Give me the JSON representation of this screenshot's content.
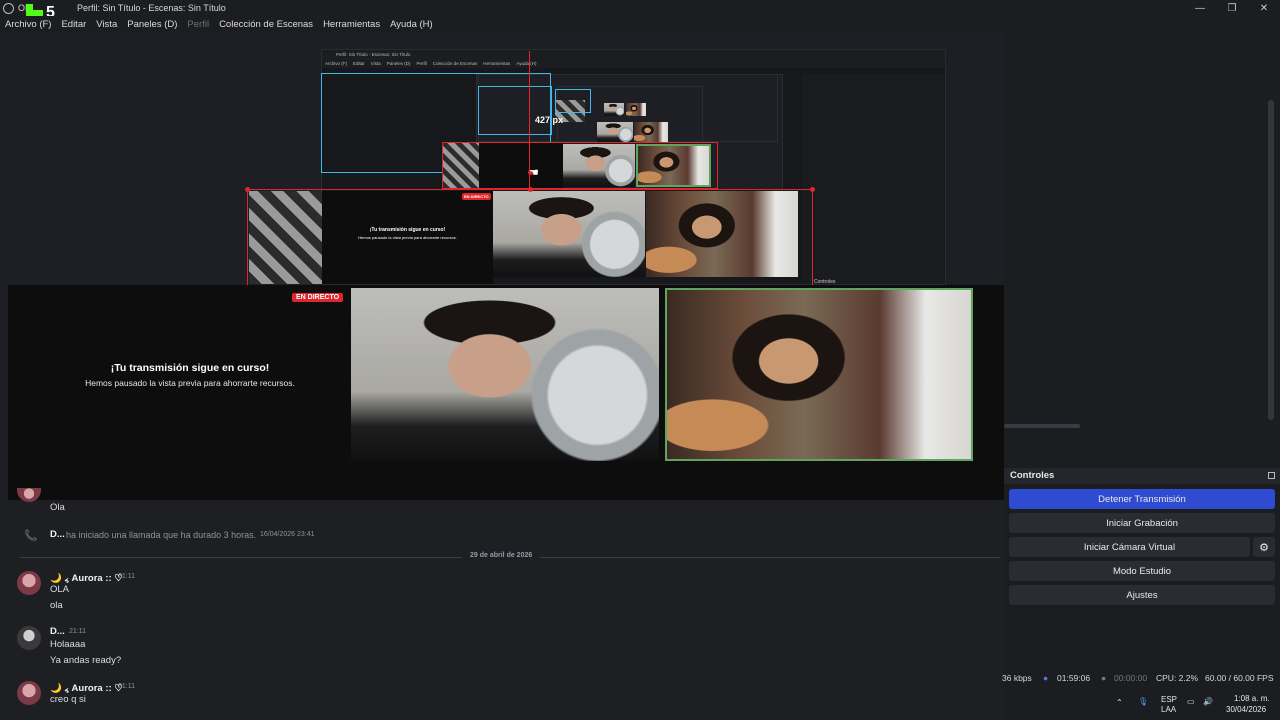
{
  "window": {
    "title": "Perfil: Sin Título - Escenas: Sin Título",
    "title_prefix": "OB",
    "minimize": "—",
    "maximize": "❐",
    "close": "✕"
  },
  "overlay_logo": {
    "letter": "K",
    "number": "5",
    "color": "#53fc18"
  },
  "menu": [
    {
      "label": "Archivo (F)",
      "disabled": false
    },
    {
      "label": "Editar",
      "disabled": false
    },
    {
      "label": "Vista",
      "disabled": false
    },
    {
      "label": "Paneles (D)",
      "disabled": false
    },
    {
      "label": "Perfil",
      "disabled": true
    },
    {
      "label": "Colección de Escenas",
      "disabled": false
    },
    {
      "label": "Herramientas",
      "disabled": false
    },
    {
      "label": "Ayuda (H)",
      "disabled": false
    }
  ],
  "preview": {
    "measure_label": "427 px",
    "live_badge": "EN DIRECTO",
    "paused_title": "¡Tu transmisión sigue en curso!",
    "paused_subtitle": "Hemos pausado la vista previa para ahorrarte recursos.",
    "nested_title": "Perfil: Sin Título - Escenas: Sin Título",
    "nested_menu": [
      "Archivo (F)",
      "Editar",
      "Vista",
      "Paneles (D)",
      "Perfil",
      "Colección de Escenas",
      "Herramientas",
      "Ayuda (H)"
    ],
    "nested_controls": "Controles",
    "highlight_color": "#e0262b",
    "selection_color": "#44b7e8"
  },
  "chat": {
    "top_message": "Ola",
    "call_user": "D...",
    "call_text": "ha iniciado una llamada que ha durado 3 horas.",
    "call_time": "16/04/2026 23:41",
    "date_divider": "29 de abril de 2026",
    "messages": [
      {
        "user": "🌙 ៹ Aurora :: ♡",
        "time": "21:11",
        "lines": [
          "OLA",
          "ola"
        ]
      },
      {
        "user": "D...",
        "time": "21:11",
        "lines": [
          "Holaaaa",
          "Ya andas ready?"
        ]
      },
      {
        "user": "🌙 ៹ Aurora :: ♡",
        "time": "21:11",
        "lines": [
          "creo q si"
        ]
      }
    ]
  },
  "controls": {
    "header": "Controles",
    "stop_stream": "Detener Transmisión",
    "start_recording": "Iniciar Grabación",
    "start_virtual_cam": "Iniciar Cámara Virtual",
    "studio_mode": "Modo Estudio",
    "settings": "Ajustes",
    "primary_color": "#2e4bd1"
  },
  "status": {
    "bitrate": "36 kbps",
    "stream_time": "01:59:06",
    "record_time": "00:00:00",
    "cpu": "CPU: 2.2%",
    "fps": "60.00 / 60.00 FPS"
  },
  "taskbar": {
    "lang_top": "ESP",
    "lang_bottom": "LAA",
    "time": "1:08 a. m.",
    "date": "30/04/2026"
  }
}
